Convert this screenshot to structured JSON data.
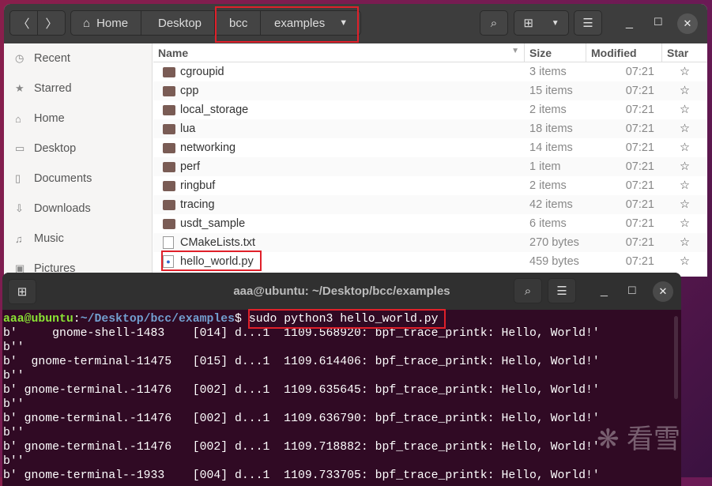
{
  "files": {
    "breadcrumb": [
      "Home",
      "Desktop",
      "bcc",
      "examples"
    ],
    "sidebar": [
      {
        "icon": "clock-icon",
        "glyph": "◷",
        "label": "Recent"
      },
      {
        "icon": "star-icon",
        "glyph": "★",
        "label": "Starred"
      },
      {
        "icon": "home-icon",
        "glyph": "⌂",
        "label": "Home"
      },
      {
        "icon": "folder-icon",
        "glyph": "▭",
        "label": "Desktop"
      },
      {
        "icon": "document-icon",
        "glyph": "▯",
        "label": "Documents"
      },
      {
        "icon": "download-icon",
        "glyph": "⇩",
        "label": "Downloads"
      },
      {
        "icon": "music-icon",
        "glyph": "♫",
        "label": "Music"
      },
      {
        "icon": "pictures-icon",
        "glyph": "▣",
        "label": "Pictures"
      }
    ],
    "columns": [
      "Name",
      "Size",
      "Modified",
      "Star"
    ],
    "rows": [
      {
        "name": "cgroupid",
        "size": "3 items",
        "modified": "07:21",
        "type": "folder"
      },
      {
        "name": "cpp",
        "size": "15 items",
        "modified": "07:21",
        "type": "folder"
      },
      {
        "name": "local_storage",
        "size": "2 items",
        "modified": "07:21",
        "type": "folder"
      },
      {
        "name": "lua",
        "size": "18 items",
        "modified": "07:21",
        "type": "folder"
      },
      {
        "name": "networking",
        "size": "14 items",
        "modified": "07:21",
        "type": "folder"
      },
      {
        "name": "perf",
        "size": "1 item",
        "modified": "07:21",
        "type": "folder"
      },
      {
        "name": "ringbuf",
        "size": "2 items",
        "modified": "07:21",
        "type": "folder"
      },
      {
        "name": "tracing",
        "size": "42 items",
        "modified": "07:21",
        "type": "folder"
      },
      {
        "name": "usdt_sample",
        "size": "6 items",
        "modified": "07:21",
        "type": "folder"
      },
      {
        "name": "CMakeLists.txt",
        "size": "270 bytes",
        "modified": "07:21",
        "type": "text"
      },
      {
        "name": "hello_world.py",
        "size": "459 bytes",
        "modified": "07:21",
        "type": "python"
      }
    ]
  },
  "terminal": {
    "title": "aaa@ubuntu: ~/Desktop/bcc/examples",
    "prompt_user": "aaa@ubuntu",
    "prompt_path": "~/Desktop/bcc/examples",
    "command": "sudo python3 hello_world.py",
    "output": [
      "b'     gnome-shell-1483    [014] d...1  1109.568920: bpf_trace_printk: Hello, World!'",
      "b''",
      "b'  gnome-terminal-11475   [015] d...1  1109.614406: bpf_trace_printk: Hello, World!'",
      "b''",
      "b' gnome-terminal.-11476   [002] d...1  1109.635645: bpf_trace_printk: Hello, World!'",
      "b''",
      "b' gnome-terminal.-11476   [002] d...1  1109.636790: bpf_trace_printk: Hello, World!'",
      "b''",
      "b' gnome-terminal.-11476   [002] d...1  1109.718882: bpf_trace_printk: Hello, World!'",
      "b''",
      "b' gnome-terminal--1933    [004] d...1  1109.733705: bpf_trace_printk: Hello, World!'"
    ]
  },
  "watermark": "看雪"
}
